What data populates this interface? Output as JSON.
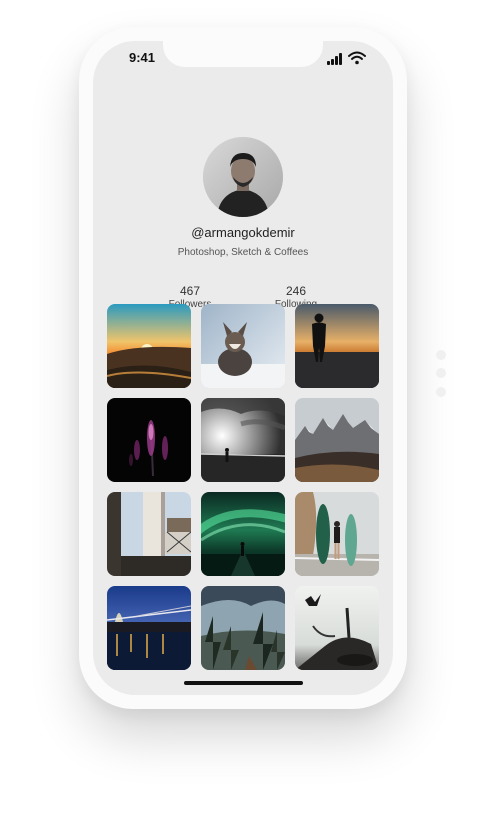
{
  "status_bar": {
    "time": "9:41"
  },
  "profile": {
    "username": "@armangokdemir",
    "bio": "Photoshop, Sketch & Coffees",
    "followers": {
      "count": "467",
      "label": "Followers"
    },
    "following": {
      "count": "246",
      "label": "Following"
    }
  },
  "photos": [
    {
      "name": "photo-sunset-hills"
    },
    {
      "name": "photo-corgi-snow"
    },
    {
      "name": "photo-person-beach-sunset"
    },
    {
      "name": "photo-purple-flowers-dark"
    },
    {
      "name": "photo-person-seaside-bw"
    },
    {
      "name": "photo-snowy-mountains"
    },
    {
      "name": "photo-city-buildings"
    },
    {
      "name": "photo-aurora-road"
    },
    {
      "name": "photo-surfers-boards"
    },
    {
      "name": "photo-bridge-night-city"
    },
    {
      "name": "photo-pine-forest"
    },
    {
      "name": "photo-driftwood-bird"
    }
  ]
}
